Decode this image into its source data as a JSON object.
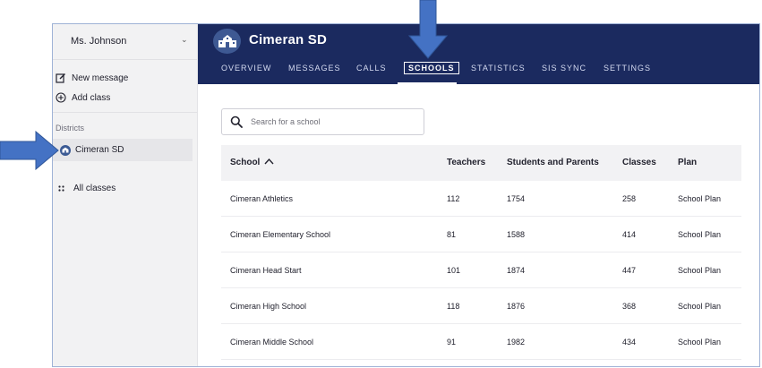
{
  "sidebar": {
    "user_name": "Ms. Johnson",
    "actions": [
      {
        "label": "New message",
        "icon": "compose-icon"
      },
      {
        "label": "Add class",
        "icon": "plus-circle-icon"
      }
    ],
    "districts_header": "Districts",
    "district_item": "Cimeran SD",
    "all_classes": "All classes"
  },
  "header": {
    "title": "Cimeran SD",
    "tabs": [
      {
        "label": "OVERVIEW"
      },
      {
        "label": "MESSAGES"
      },
      {
        "label": "CALLS"
      },
      {
        "label": "SCHOOLS",
        "active": true
      },
      {
        "label": "STATISTICS"
      },
      {
        "label": "SIS SYNC"
      },
      {
        "label": "SETTINGS"
      }
    ]
  },
  "search": {
    "placeholder": "Search for a school",
    "value": ""
  },
  "table": {
    "columns": [
      "School",
      "Teachers",
      "Students and Parents",
      "Classes",
      "Plan"
    ],
    "sort": {
      "column": "School",
      "direction": "ascending"
    },
    "rows": [
      [
        "Cimeran Athletics",
        "112",
        "1754",
        "258",
        "School Plan"
      ],
      [
        "Cimeran Elementary School",
        "81",
        "1588",
        "414",
        "School Plan"
      ],
      [
        "Cimeran Head Start",
        "101",
        "1874",
        "447",
        "School Plan"
      ],
      [
        "Cimeran High School",
        "118",
        "1876",
        "368",
        "School Plan"
      ],
      [
        "Cimeran Middle School",
        "91",
        "1982",
        "434",
        "School Plan"
      ]
    ]
  },
  "colors": {
    "header_bg": "#1b2a5f",
    "sidebar_bg": "#f2f2f3",
    "arrow": "#4472c4",
    "logo": "#3e5993"
  }
}
